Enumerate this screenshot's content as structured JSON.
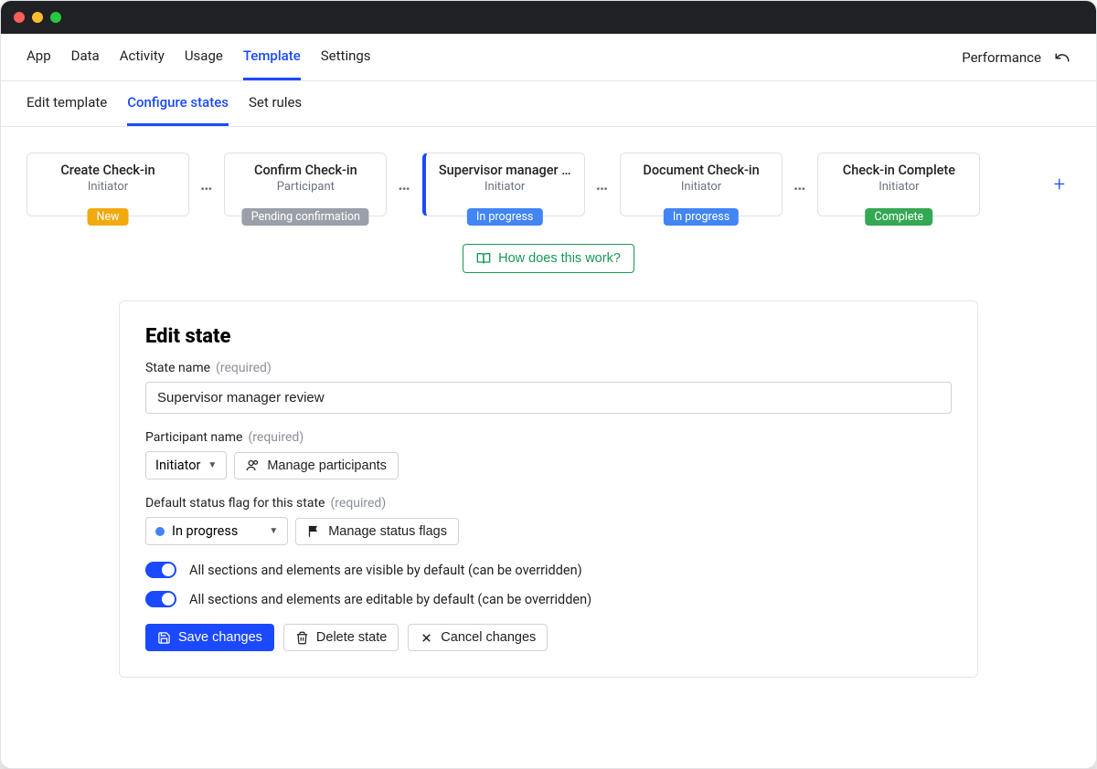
{
  "topNav": {
    "items": [
      {
        "label": "App"
      },
      {
        "label": "Data"
      },
      {
        "label": "Activity"
      },
      {
        "label": "Usage"
      },
      {
        "label": "Template",
        "active": true
      },
      {
        "label": "Settings"
      }
    ],
    "rightLabel": "Performance"
  },
  "subNav": {
    "items": [
      {
        "label": "Edit template"
      },
      {
        "label": "Configure states",
        "active": true
      },
      {
        "label": "Set rules"
      }
    ]
  },
  "states": [
    {
      "title": "Create Check-in",
      "role": "Initiator",
      "badge": "New",
      "badgeClass": "badge-new"
    },
    {
      "title": "Confirm Check-in",
      "role": "Participant",
      "badge": "Pending confirmation",
      "badgeClass": "badge-pending"
    },
    {
      "title": "Supervisor manager …",
      "role": "Initiator",
      "badge": "In progress",
      "badgeClass": "badge-progress",
      "selected": true
    },
    {
      "title": "Document Check-in",
      "role": "Initiator",
      "badge": "In progress",
      "badgeClass": "badge-progress"
    },
    {
      "title": "Check-in Complete",
      "role": "Initiator",
      "badge": "Complete",
      "badgeClass": "badge-complete"
    }
  ],
  "helpLabel": "How does this work?",
  "panel": {
    "heading": "Edit state",
    "stateNameLabel": "State name",
    "required": "(required)",
    "stateNameValue": "Supervisor manager review",
    "participantLabel": "Participant name",
    "participantValue": "Initiator",
    "manageParticipants": "Manage participants",
    "statusFlagLabel": "Default status flag for this state",
    "statusFlagValue": "In progress",
    "manageStatusFlags": "Manage status flags",
    "toggle1": "All sections and elements are visible by default (can be overridden)",
    "toggle2": "All sections and elements are editable by default (can be overridden)",
    "saveBtn": "Save changes",
    "deleteBtn": "Delete state",
    "cancelBtn": "Cancel changes"
  }
}
